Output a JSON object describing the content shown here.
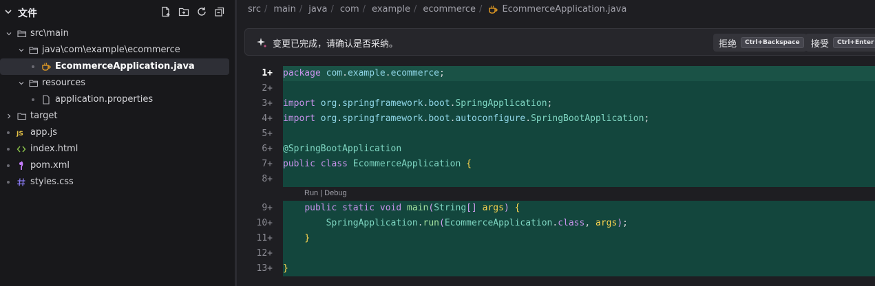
{
  "sidebar": {
    "title": "文件",
    "actions": [
      "new-file-icon",
      "new-folder-icon",
      "refresh-icon",
      "collapse-all-icon"
    ],
    "tree": [
      {
        "label": "src\\main",
        "kind": "folder-open",
        "chevron": "down"
      },
      {
        "label": "java\\com\\example\\ecommerce",
        "kind": "folder-open",
        "chevron": "down"
      },
      {
        "label": "EcommerceApplication.java",
        "kind": "java-file",
        "selected": true
      },
      {
        "label": "resources",
        "kind": "folder-open",
        "chevron": "down"
      },
      {
        "label": "application.properties",
        "kind": "text-file"
      },
      {
        "label": "target",
        "kind": "folder",
        "chevron": "right"
      },
      {
        "label": "app.js",
        "kind": "js-file"
      },
      {
        "label": "index.html",
        "kind": "html-file"
      },
      {
        "label": "pom.xml",
        "kind": "xml-file"
      },
      {
        "label": "styles.css",
        "kind": "css-file"
      }
    ]
  },
  "breadcrumb": [
    "src",
    "main",
    "java",
    "com",
    "example",
    "ecommerce",
    "EcommerceApplication.java"
  ],
  "banner": {
    "message": "变更已完成，请确认是否采纳。",
    "reject_label": "拒绝",
    "reject_shortcut": "Ctrl+Backspace",
    "accept_label": "接受",
    "accept_shortcut": "Ctrl+Enter"
  },
  "editor": {
    "line_numbers": [
      "1+",
      "2+",
      "3+",
      "4+",
      "5+",
      "6+",
      "7+",
      "8+",
      "9+",
      "10+",
      "11+",
      "12+",
      "13+"
    ],
    "codelens": "Run | Debug",
    "lines": [
      "package com.example.ecommerce;",
      "",
      "import org.springframework.boot.SpringApplication;",
      "import org.springframework.boot.autoconfigure.SpringBootApplication;",
      "",
      "@SpringBootApplication",
      "public class EcommerceApplication {",
      "",
      "    public static void main(String[] args) {",
      "        SpringApplication.run(EcommerceApplication.class, args);",
      "    }",
      "",
      "}"
    ]
  },
  "colors": {
    "added_line_bg": "#13463d",
    "keyword": "#c792ea",
    "type": "#7fd6c2",
    "brace": "#f9d34f",
    "sidebar_bg": "#18181b",
    "editor_bg": "#1e1e22"
  }
}
